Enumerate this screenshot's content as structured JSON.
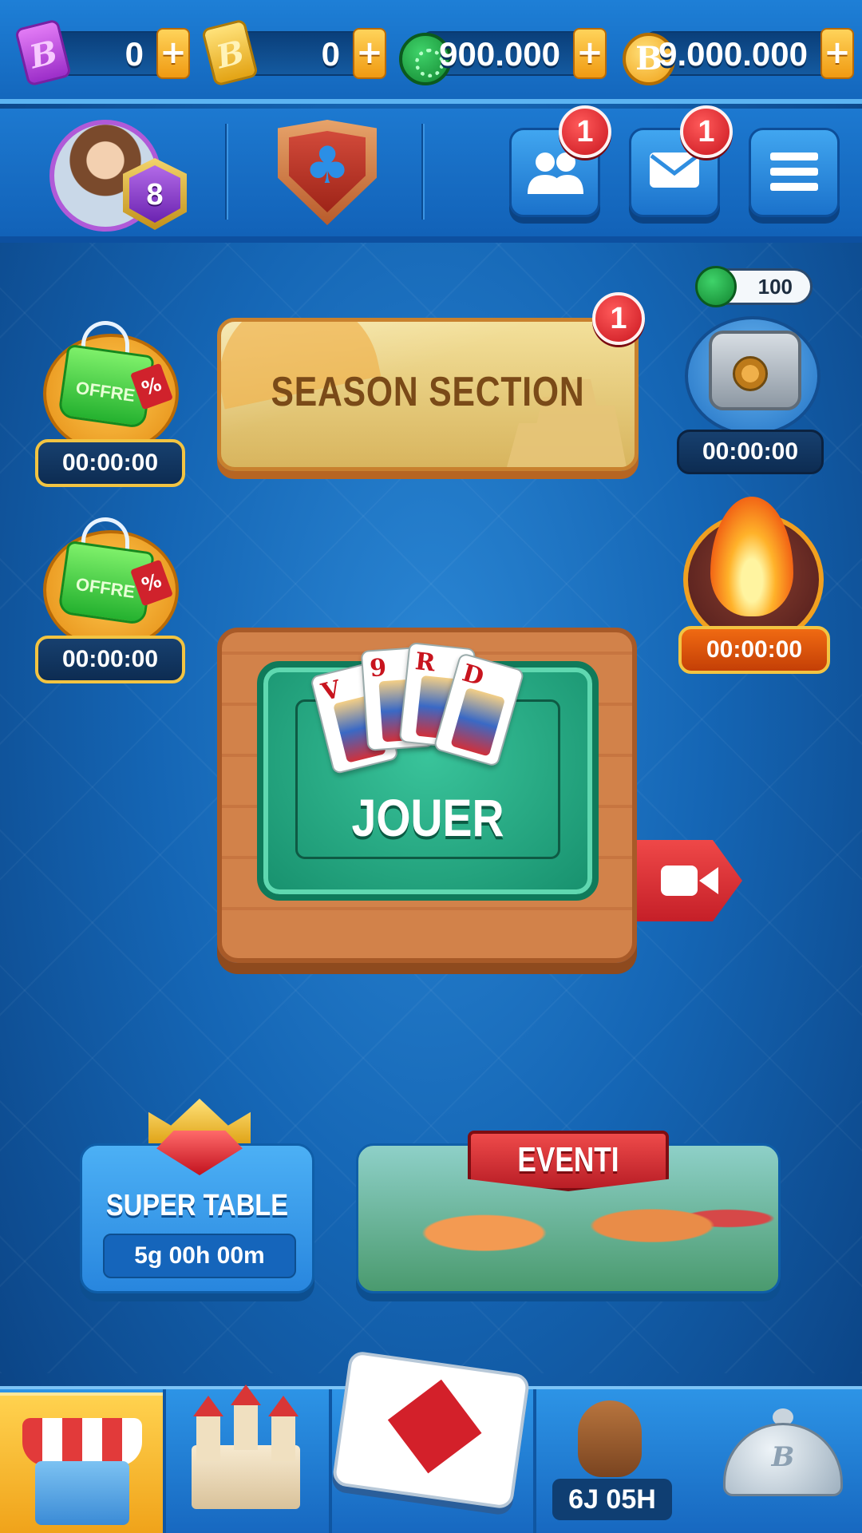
{
  "currencies": {
    "purple_ticket": {
      "icon": "purple-ticket-icon",
      "value": "0",
      "plus": "+"
    },
    "gold_ticket": {
      "icon": "gold-ticket-icon",
      "value": "0",
      "plus": "+"
    },
    "gems": {
      "icon": "green-gem-icon",
      "value": "900.000",
      "plus": "+"
    },
    "coins": {
      "icon": "gold-coin-icon",
      "value": "9.000.000",
      "plus": "+"
    }
  },
  "header": {
    "level": "8",
    "friends_badge": "1",
    "mail_badge": "1"
  },
  "side_widgets": {
    "offer_top": {
      "label": "OFFRE",
      "tag": "%",
      "timer": "00:00:00"
    },
    "offer_bottom": {
      "label": "OFFRE",
      "tag": "%",
      "timer": "00:00:00"
    },
    "safe": {
      "bubble_value": "100",
      "timer": "00:00:00"
    },
    "fire": {
      "timer": "00:00:00"
    }
  },
  "season": {
    "title": "SEASON SECTION",
    "badge": "1"
  },
  "play": {
    "label": "JOUER",
    "cards": [
      "V",
      "9",
      "R",
      "D"
    ]
  },
  "super_table": {
    "label": "SUPER TABLE",
    "countdown": "5g 00h 00m"
  },
  "events": {
    "label": "EVENTI"
  },
  "bottom_nav": {
    "timer": "6J 05H",
    "cloche_letter": "B"
  },
  "colors": {
    "bg_blue": "#1566b5",
    "accent_yellow": "#f0a31a",
    "play_green": "#17906d",
    "notif_red": "#c9161f"
  }
}
